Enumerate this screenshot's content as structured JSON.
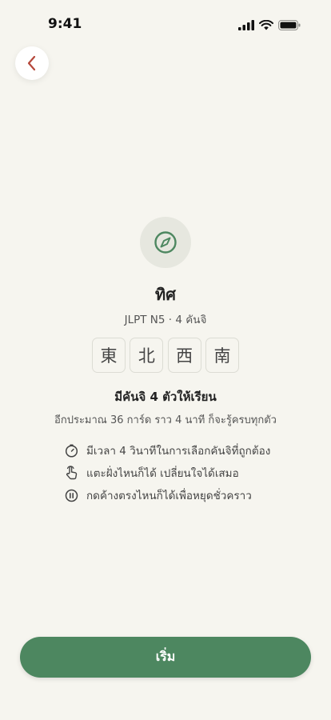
{
  "status_bar": {
    "time": "9:41"
  },
  "header": {
    "back_icon": "chevron-left-icon"
  },
  "lesson": {
    "icon": "compass-icon",
    "title": "ทิศ",
    "subtitle": "JLPT N5 · 4 คันจิ",
    "kanji": [
      "東",
      "北",
      "西",
      "南"
    ],
    "count_text": "มีคันจิ 4 ตัวให้เรียน",
    "estimate_text": "อีกประมาณ 36 การ์ด ราว 4 นาที ก็จะรู้ครบทุกตัว"
  },
  "tips": [
    {
      "icon": "timer-icon",
      "text": "มีเวลา 4 วินาทีในการเลือกคันจิที่ถูกต้อง"
    },
    {
      "icon": "tap-hand-icon",
      "text": "แตะฝั่งไหนก็ได้ เปลี่ยนใจได้เสมอ"
    },
    {
      "icon": "pause-icon",
      "text": "กดค้างตรงไหนก็ได้เพื่อหยุดชั่วคราว"
    }
  ],
  "footer": {
    "start_label": "เริ่ม"
  },
  "colors": {
    "accent": "#4d8760",
    "back_chevron": "#b5473a",
    "background": "#f6f5ef"
  }
}
